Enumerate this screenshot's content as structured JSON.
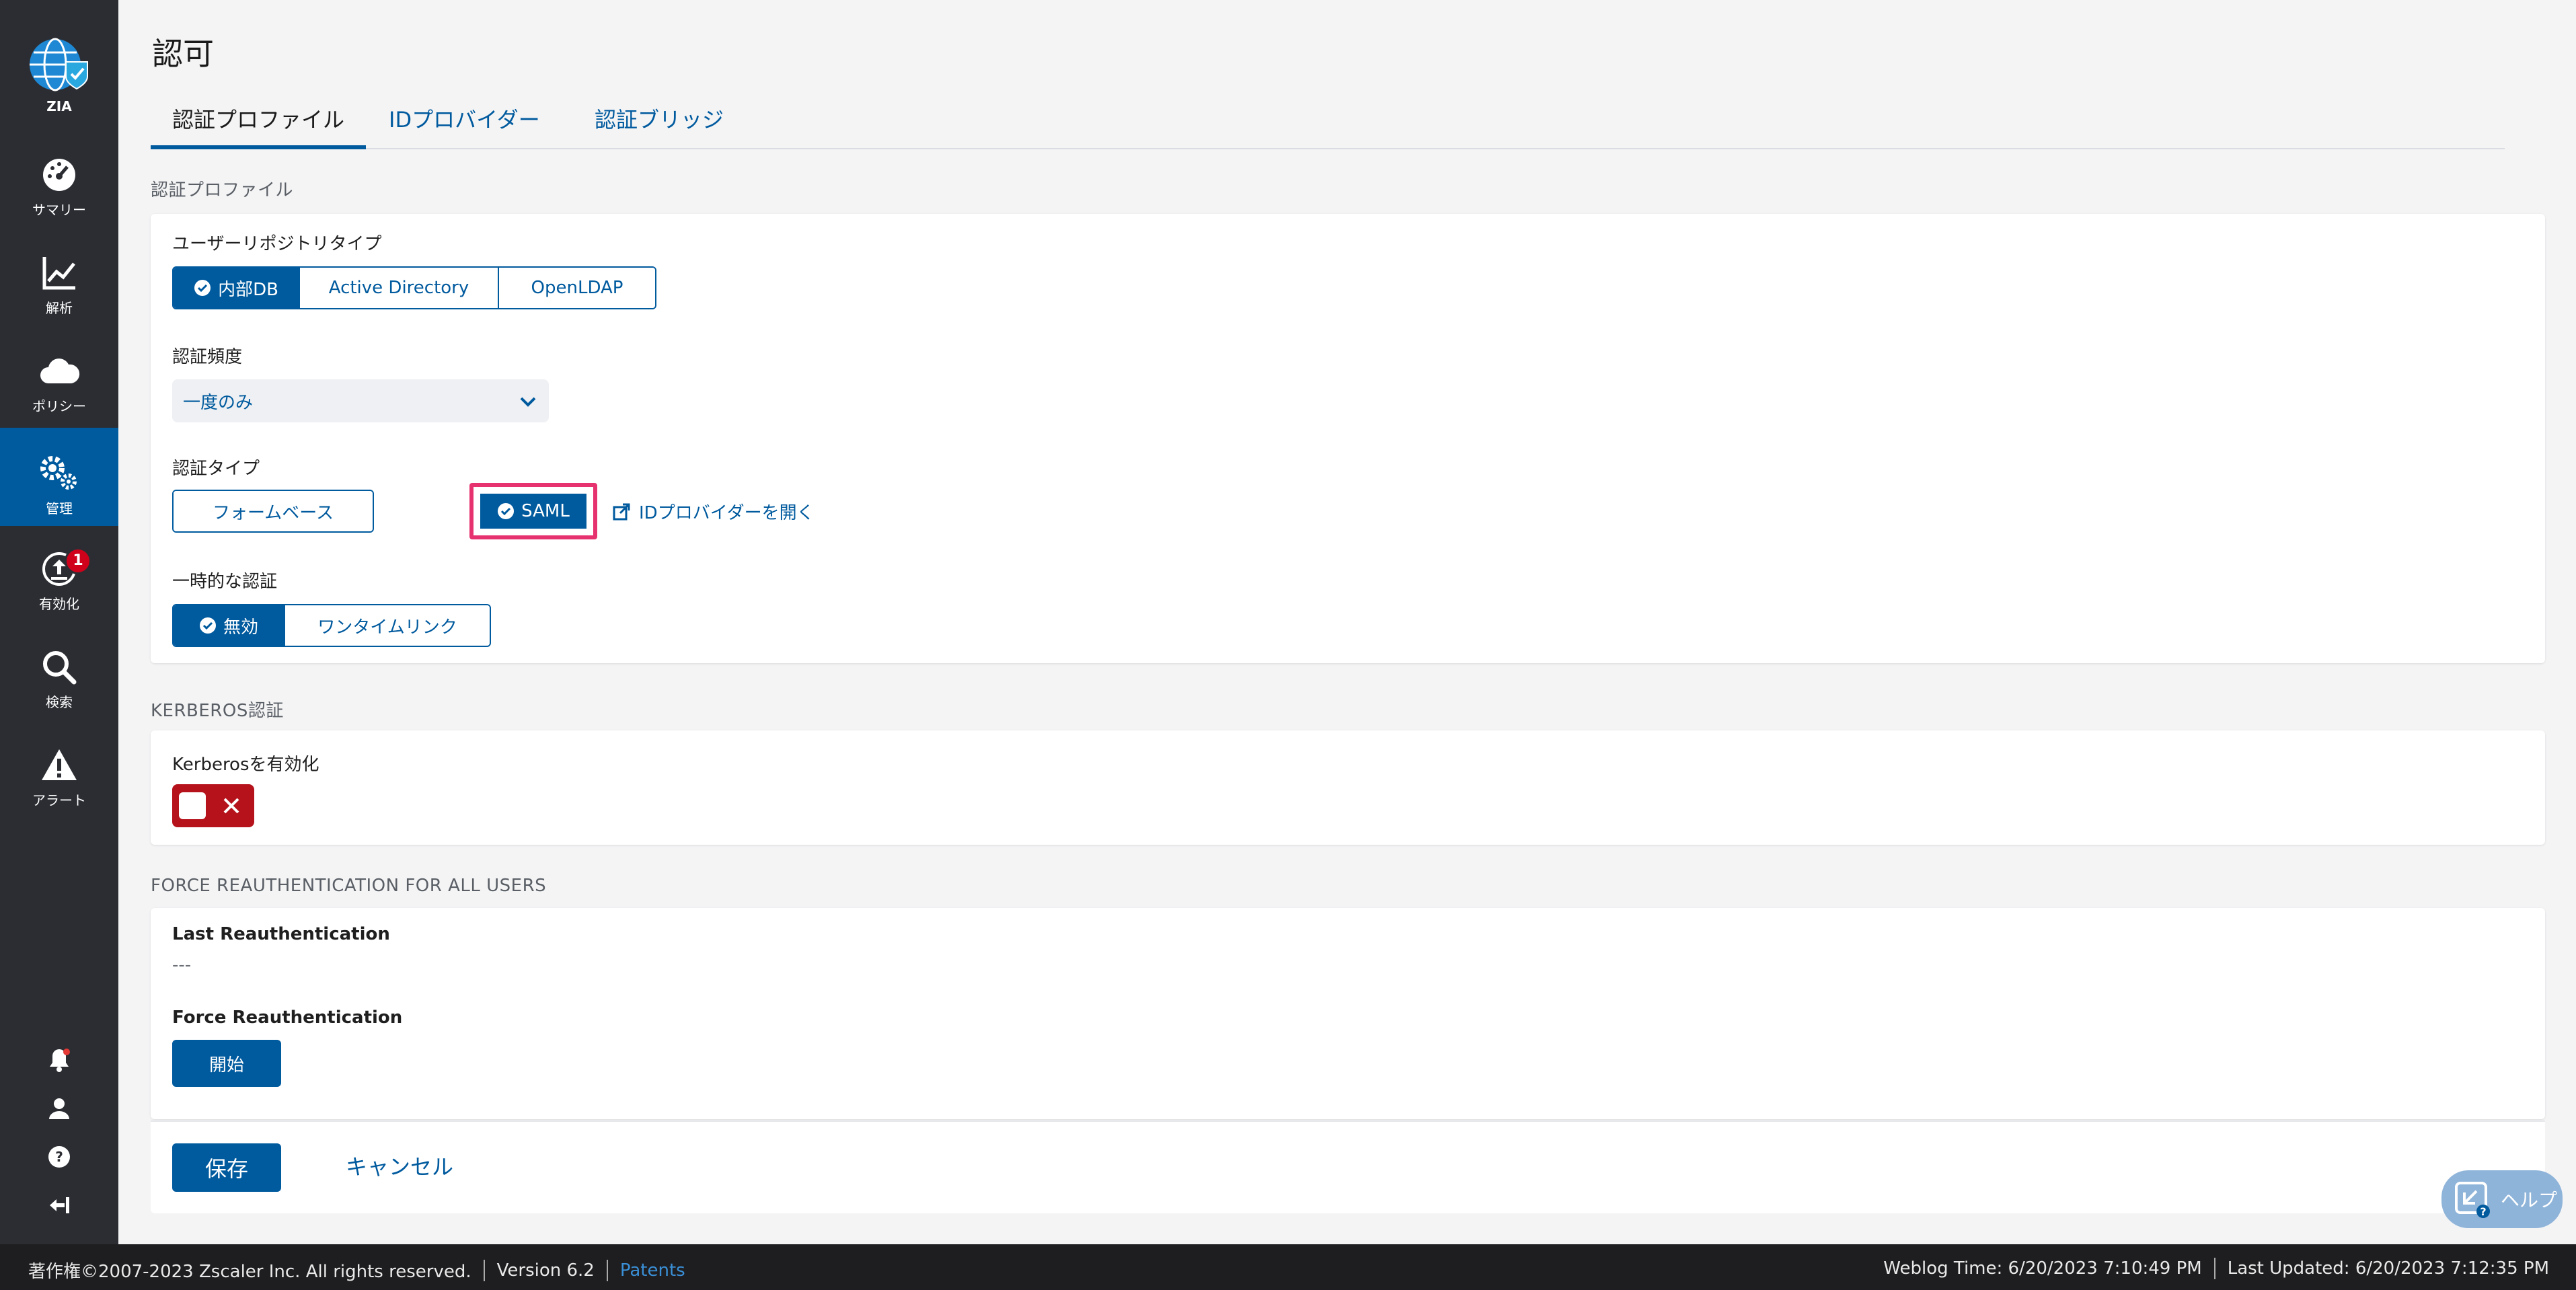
{
  "colors": {
    "sidebar_bg": "#2b2d33",
    "sidebar_active": "#005a9e",
    "accent": "#005a9e",
    "highlight_border": "#e6336f",
    "toggle_off": "#b5121b",
    "badge": "#d0021b",
    "footer_bg": "#1e1e20",
    "footer_link": "#3a8fd6"
  },
  "sidebar": {
    "logo": {
      "label": "ZIA",
      "icon": "globe-check-icon"
    },
    "items": [
      {
        "label": "サマリー",
        "icon": "dashboard-icon"
      },
      {
        "label": "解析",
        "icon": "line-chart-icon"
      },
      {
        "label": "ポリシー",
        "icon": "cloud-icon"
      },
      {
        "label": "管理",
        "icon": "gears-icon",
        "active": true
      },
      {
        "label": "有効化",
        "icon": "activate-icon",
        "badge": "1"
      },
      {
        "label": "検索",
        "icon": "search-icon"
      },
      {
        "label": "アラート",
        "icon": "alert-icon"
      }
    ],
    "bottom_icons": [
      "bell-icon",
      "user-icon",
      "help-circle-icon",
      "logout-icon"
    ]
  },
  "page": {
    "title": "認可",
    "tabs": [
      {
        "label": "認証プロファイル",
        "active": true
      },
      {
        "label": "IDプロバイダー"
      },
      {
        "label": "認証ブリッジ"
      }
    ]
  },
  "auth_profile": {
    "section_title": "認証プロファイル",
    "repo_type": {
      "label": "ユーザーリポジトリタイプ",
      "options": [
        "内部DB",
        "Active Directory",
        "OpenLDAP"
      ],
      "selected": "内部DB"
    },
    "frequency": {
      "label": "認証頻度",
      "value": "一度のみ"
    },
    "auth_type": {
      "label": "認証タイプ",
      "options": [
        "フォームベース",
        "SAML"
      ],
      "selected": "SAML",
      "open_idp_link": "IDプロバイダーを開く"
    },
    "temp_auth": {
      "label": "一時的な認証",
      "options": [
        "無効",
        "ワンタイムリンク"
      ],
      "selected": "無効"
    }
  },
  "kerberos": {
    "section_title": "KERBEROS認証",
    "enable_label": "Kerberosを有効化",
    "enabled": false
  },
  "force_reauth": {
    "section_title": "FORCE REAUTHENTICATION FOR ALL USERS",
    "last_label": "Last Reauthentication",
    "last_value": "---",
    "force_label": "Force Reauthentication",
    "start_button": "開始"
  },
  "actions": {
    "save": "保存",
    "cancel": "キャンセル"
  },
  "help": {
    "label": "ヘルプ"
  },
  "footer": {
    "copyright": "著作権©2007-2023 Zscaler Inc. All rights reserved.",
    "version": "Version 6.2",
    "patents": "Patents",
    "weblog_time": "Weblog Time: 6/20/2023 7:10:49 PM",
    "last_updated": "Last Updated: 6/20/2023 7:12:35 PM"
  }
}
